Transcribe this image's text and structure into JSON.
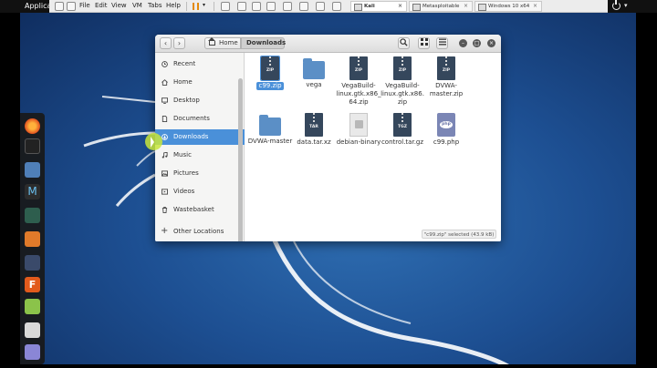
{
  "top": {
    "apps_label": "Applica"
  },
  "vm": {
    "menus": [
      "File",
      "Edit",
      "View",
      "VM",
      "Tabs",
      "Help"
    ],
    "tabs": [
      {
        "label": "Kali",
        "active": true
      },
      {
        "label": "Metasploitable",
        "active": false
      },
      {
        "label": "Windows 10 x64",
        "active": false
      }
    ]
  },
  "window": {
    "breadcrumbs": [
      "Home",
      "Downloads"
    ],
    "status": "\"c99.zip\" selected  (43.9 kB)"
  },
  "sidebar": {
    "items": [
      {
        "label": "Recent",
        "icon": "clock-icon"
      },
      {
        "label": "Home",
        "icon": "home-icon"
      },
      {
        "label": "Desktop",
        "icon": "desktop-icon"
      },
      {
        "label": "Documents",
        "icon": "document-icon"
      },
      {
        "label": "Downloads",
        "icon": "download-icon",
        "selected": true
      },
      {
        "label": "Music",
        "icon": "music-icon"
      },
      {
        "label": "Pictures",
        "icon": "picture-icon"
      },
      {
        "label": "Videos",
        "icon": "video-icon"
      },
      {
        "label": "Wastebasket",
        "icon": "trash-icon"
      }
    ],
    "other_locations": "Other Locations"
  },
  "files": [
    {
      "name": "c99.zip",
      "kind": "zip",
      "tag": "ZIP",
      "selected": true
    },
    {
      "name": "vega",
      "kind": "folder"
    },
    {
      "name": "VegaBuild-linux.gtk.x86_64.zip",
      "kind": "zip",
      "tag": "ZIP"
    },
    {
      "name": "VegaBuild-linux.gtk.x86.zip",
      "kind": "zip",
      "tag": "ZIP"
    },
    {
      "name": "DVWA-master.zip",
      "kind": "zip",
      "tag": "ZIP"
    },
    {
      "name": "DVWA-master",
      "kind": "folder"
    },
    {
      "name": "data.tar.xz",
      "kind": "zip",
      "tag": "TAR"
    },
    {
      "name": "debian-binary",
      "kind": "doc"
    },
    {
      "name": "control.tar.gz",
      "kind": "zip",
      "tag": "TGZ"
    },
    {
      "name": "c99.php",
      "kind": "php",
      "tag": "php"
    }
  ],
  "colors": {
    "accent": "#4a90d9",
    "wallpaper": "#1d4f92",
    "zip_icon": "#35475c",
    "folder_icon": "#5b8fc6"
  }
}
